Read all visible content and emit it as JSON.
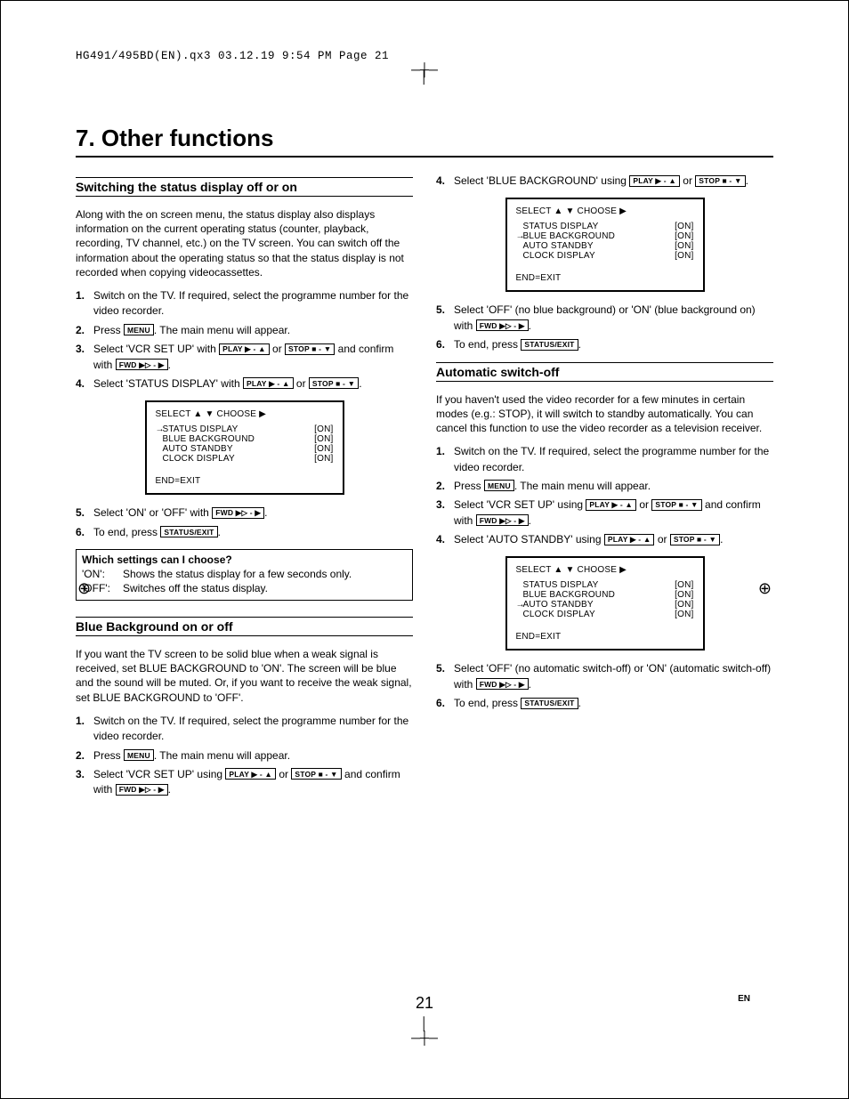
{
  "header": "HG491/495BD(EN).qx3  03.12.19  9:54 PM  Page 21",
  "chapter": "7. Other functions",
  "keys": {
    "menu": "MENU",
    "play": "PLAY ▶ - ▲",
    "stop": "STOP ■ - ▼",
    "fwd": "FWD ▶▷ - ▶",
    "status": "STATUS/EXIT"
  },
  "osd": {
    "header": "SELECT ▲ ▼   CHOOSE ▶",
    "rows": [
      {
        "label": "STATUS DISPLAY",
        "value": "[ON]"
      },
      {
        "label": "BLUE BACKGROUND",
        "value": "[ON]"
      },
      {
        "label": "AUTO STANDBY",
        "value": "[ON]"
      },
      {
        "label": "CLOCK DISPLAY",
        "value": "[ON]"
      }
    ],
    "footer": "END=EXIT"
  },
  "left": {
    "sec1": {
      "title": "Switching the status display off or on",
      "intro": "Along with the on screen menu, the status display also displays information on the current operating status (counter, playback, recording, TV channel, etc.) on the TV screen. You can switch off the information about the operating status so that the status display is not recorded when copying videocassettes.",
      "s1": "Switch on the TV. If required, select the programme number for the video recorder.",
      "s2a": "Press ",
      "s2b": ". The main menu will appear.",
      "s3a": "Select 'VCR SET UP' with ",
      "s3b": " or ",
      "s3c": " and confirm with ",
      "s3d": ".",
      "s4a": "Select 'STATUS DISPLAY' with ",
      "s4b": " or ",
      "s4c": ".",
      "s5a": "Select 'ON' or 'OFF' with ",
      "s5b": ".",
      "s6a": "To end, press ",
      "s6b": ".",
      "boxTitle": "Which settings can I choose?",
      "boxOnK": "'ON':",
      "boxOnV": "Shows the status display for a few seconds only.",
      "boxOffK": "'OFF':",
      "boxOffV": "Switches off the status display."
    },
    "sec2": {
      "title": "Blue Background on or off",
      "intro": "If you want the TV screen to be solid blue when a weak signal is received, set BLUE BACKGROUND to 'ON'. The screen will be blue and the sound will be muted. Or, if you want to receive the weak signal, set BLUE BACKGROUND to 'OFF'.",
      "s1": "Switch on the TV. If required, select the programme number for the video recorder.",
      "s2a": "Press ",
      "s2b": ". The main menu will appear.",
      "s3a": "Select 'VCR SET UP' using ",
      "s3b": " or ",
      "s3c": " and confirm with ",
      "s3d": "."
    }
  },
  "right": {
    "sec2": {
      "s4a": "Select 'BLUE BACKGROUND' using ",
      "s4b": " or ",
      "s4c": ".",
      "s5a": "Select 'OFF' (no blue background) or 'ON' (blue background on) with ",
      "s5b": ".",
      "s6a": "To end, press ",
      "s6b": "."
    },
    "sec3": {
      "title": "Automatic switch-off",
      "intro": "If you haven't used the video recorder for a few minutes in certain modes (e.g.: STOP), it will switch to standby automatically. You can cancel this function to use the video recorder as a television receiver.",
      "s1": "Switch on the TV. If required, select the programme number for the video recorder.",
      "s2a": "Press ",
      "s2b": ". The main menu will appear.",
      "s3a": "Select 'VCR SET UP' using ",
      "s3b": " or ",
      "s3c": " and confirm with ",
      "s3d": ".",
      "s4a": "Select 'AUTO STANDBY' using ",
      "s4b": " or ",
      "s4c": ".",
      "s5a": "Select 'OFF' (no automatic switch-off) or 'ON' (automatic switch-off) with ",
      "s5b": ".",
      "s6a": "To end, press ",
      "s6b": "."
    }
  },
  "pageNumber": "21",
  "lang": "EN"
}
